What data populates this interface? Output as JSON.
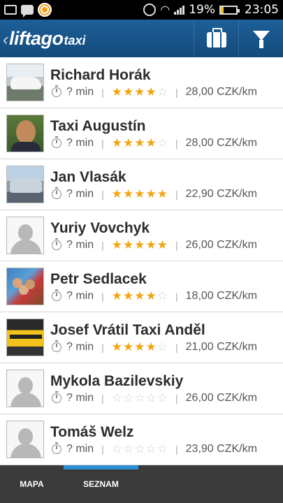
{
  "status_bar": {
    "battery_percent": "19%",
    "time": "23:05",
    "icons": [
      "gallery-icon",
      "message-icon",
      "app-notification-icon",
      "alarm-icon",
      "wifi-icon",
      "signal-icon",
      "battery-icon"
    ]
  },
  "app_bar": {
    "brand_main": "liftago",
    "brand_sub": "taxi",
    "actions": [
      "briefcase-icon",
      "filter-icon"
    ]
  },
  "drivers": [
    {
      "name": "Richard Horák",
      "eta": "? min",
      "rating": 4,
      "price": "28,00 CZK/km",
      "avatar": "car-white"
    },
    {
      "name": "Taxi Augustín",
      "eta": "? min",
      "rating": 4,
      "price": "28,00 CZK/km",
      "avatar": "person"
    },
    {
      "name": "Jan Vlasák",
      "eta": "? min",
      "rating": 5,
      "price": "22,90 CZK/km",
      "avatar": "car-silver"
    },
    {
      "name": "Yuriy Vovchyk",
      "eta": "? min",
      "rating": 5,
      "price": "26,00 CZK/km",
      "avatar": "placeholder"
    },
    {
      "name": "Petr Sedlacek",
      "eta": "? min",
      "rating": 4,
      "price": "18,00 CZK/km",
      "avatar": "group"
    },
    {
      "name": "Josef Vrátil Taxi Anděl",
      "eta": "? min",
      "rating": 4,
      "price": "21,00 CZK/km",
      "avatar": "taxi"
    },
    {
      "name": "Mykola Bazilevskiy",
      "eta": "? min",
      "rating": 0,
      "price": "26,00 CZK/km",
      "avatar": "placeholder"
    },
    {
      "name": "Tomáš Welz",
      "eta": "? min",
      "rating": 0,
      "price": "23,90 CZK/km",
      "avatar": "placeholder"
    }
  ],
  "tabs": [
    {
      "label": "MAPA",
      "active": false
    },
    {
      "label": "SEZNAM",
      "active": true
    }
  ],
  "colors": {
    "app_bar": "#1a5a90",
    "star": "#f2a411",
    "tab_indicator": "#2d8fd3",
    "tab_bar": "#3a3a3a"
  }
}
